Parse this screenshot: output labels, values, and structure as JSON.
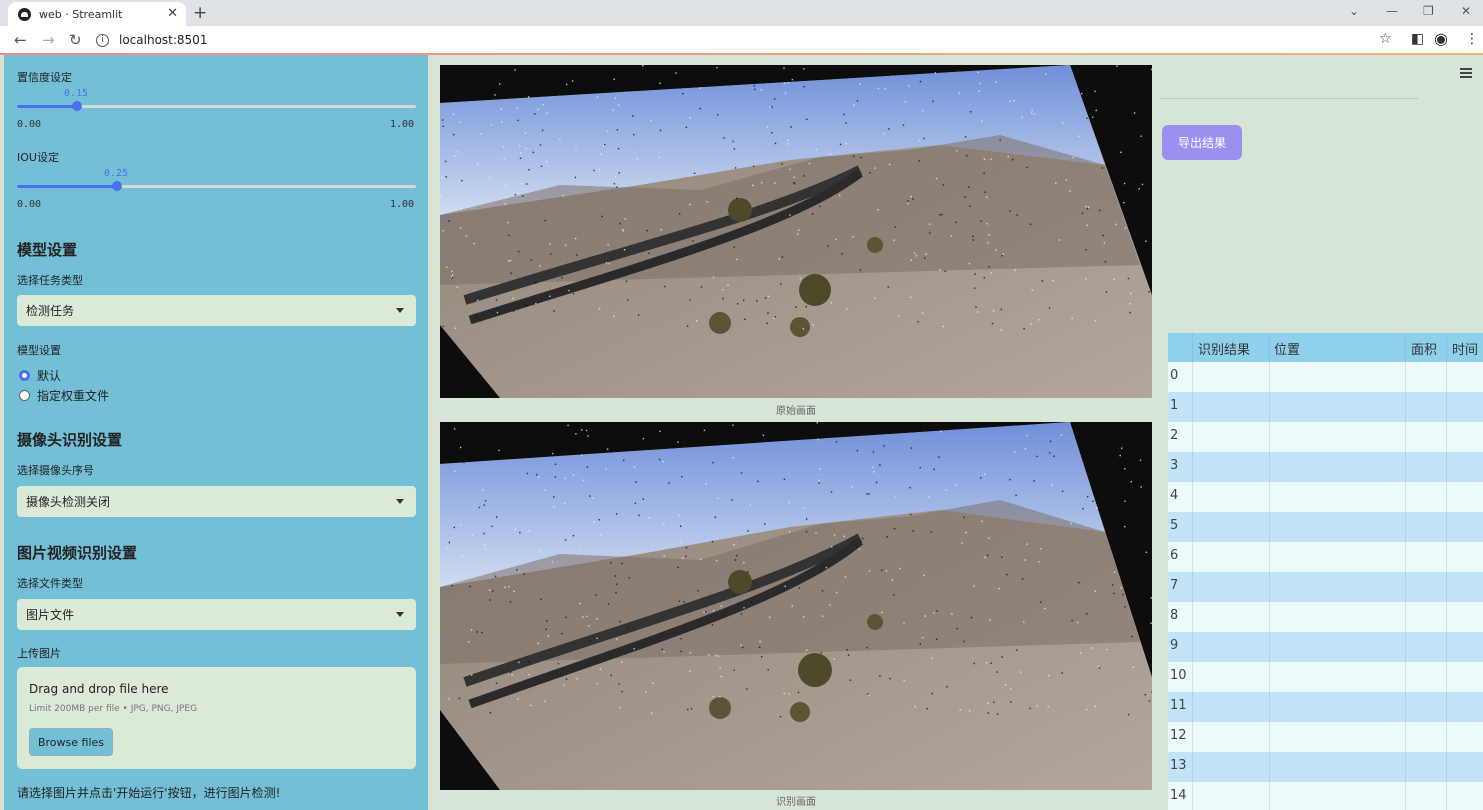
{
  "browser": {
    "tab_title": "web · Streamlit",
    "url": "localhost:8501",
    "close_glyph": "✕",
    "new_tab_glyph": "+"
  },
  "sidebar": {
    "confidence": {
      "label": "置信度设定",
      "value_text": "0.15",
      "value": 0.15,
      "min": "0.00",
      "max": "1.00"
    },
    "iou": {
      "label": "IOU设定",
      "value_text": "0.25",
      "value": 0.25,
      "min": "0.00",
      "max": "1.00"
    },
    "model_section": {
      "heading": "模型设置",
      "task_label": "选择任务类型",
      "task_value": "检测任务",
      "model_label": "模型设置",
      "radio_options": [
        "默认",
        "指定权重文件"
      ],
      "radio_selected": 0
    },
    "camera_section": {
      "heading": "摄像头识别设置",
      "label": "选择摄像头序号",
      "value": "摄像头检测关闭"
    },
    "media_section": {
      "heading": "图片视频识别设置",
      "file_type_label": "选择文件类型",
      "file_type_value": "图片文件",
      "upload_label": "上传图片"
    },
    "uploader": {
      "drag_text": "Drag and drop file here",
      "limit_text": "Limit 200MB per file • JPG, PNG, JPEG",
      "button": "Browse files"
    },
    "footer_text": "请选择图片并点击'开始运行'按钮，进行图片检测!"
  },
  "main": {
    "original_caption": "原始画面",
    "result_caption": "识别画面"
  },
  "right": {
    "export_button": "导出结果",
    "table": {
      "columns": [
        "识别结果",
        "位置",
        "面积",
        "时间"
      ],
      "row_indices": [
        "0",
        "1",
        "2",
        "3",
        "4",
        "5",
        "6",
        "7",
        "8",
        "9",
        "10",
        "11",
        "12",
        "13",
        "14"
      ]
    }
  }
}
